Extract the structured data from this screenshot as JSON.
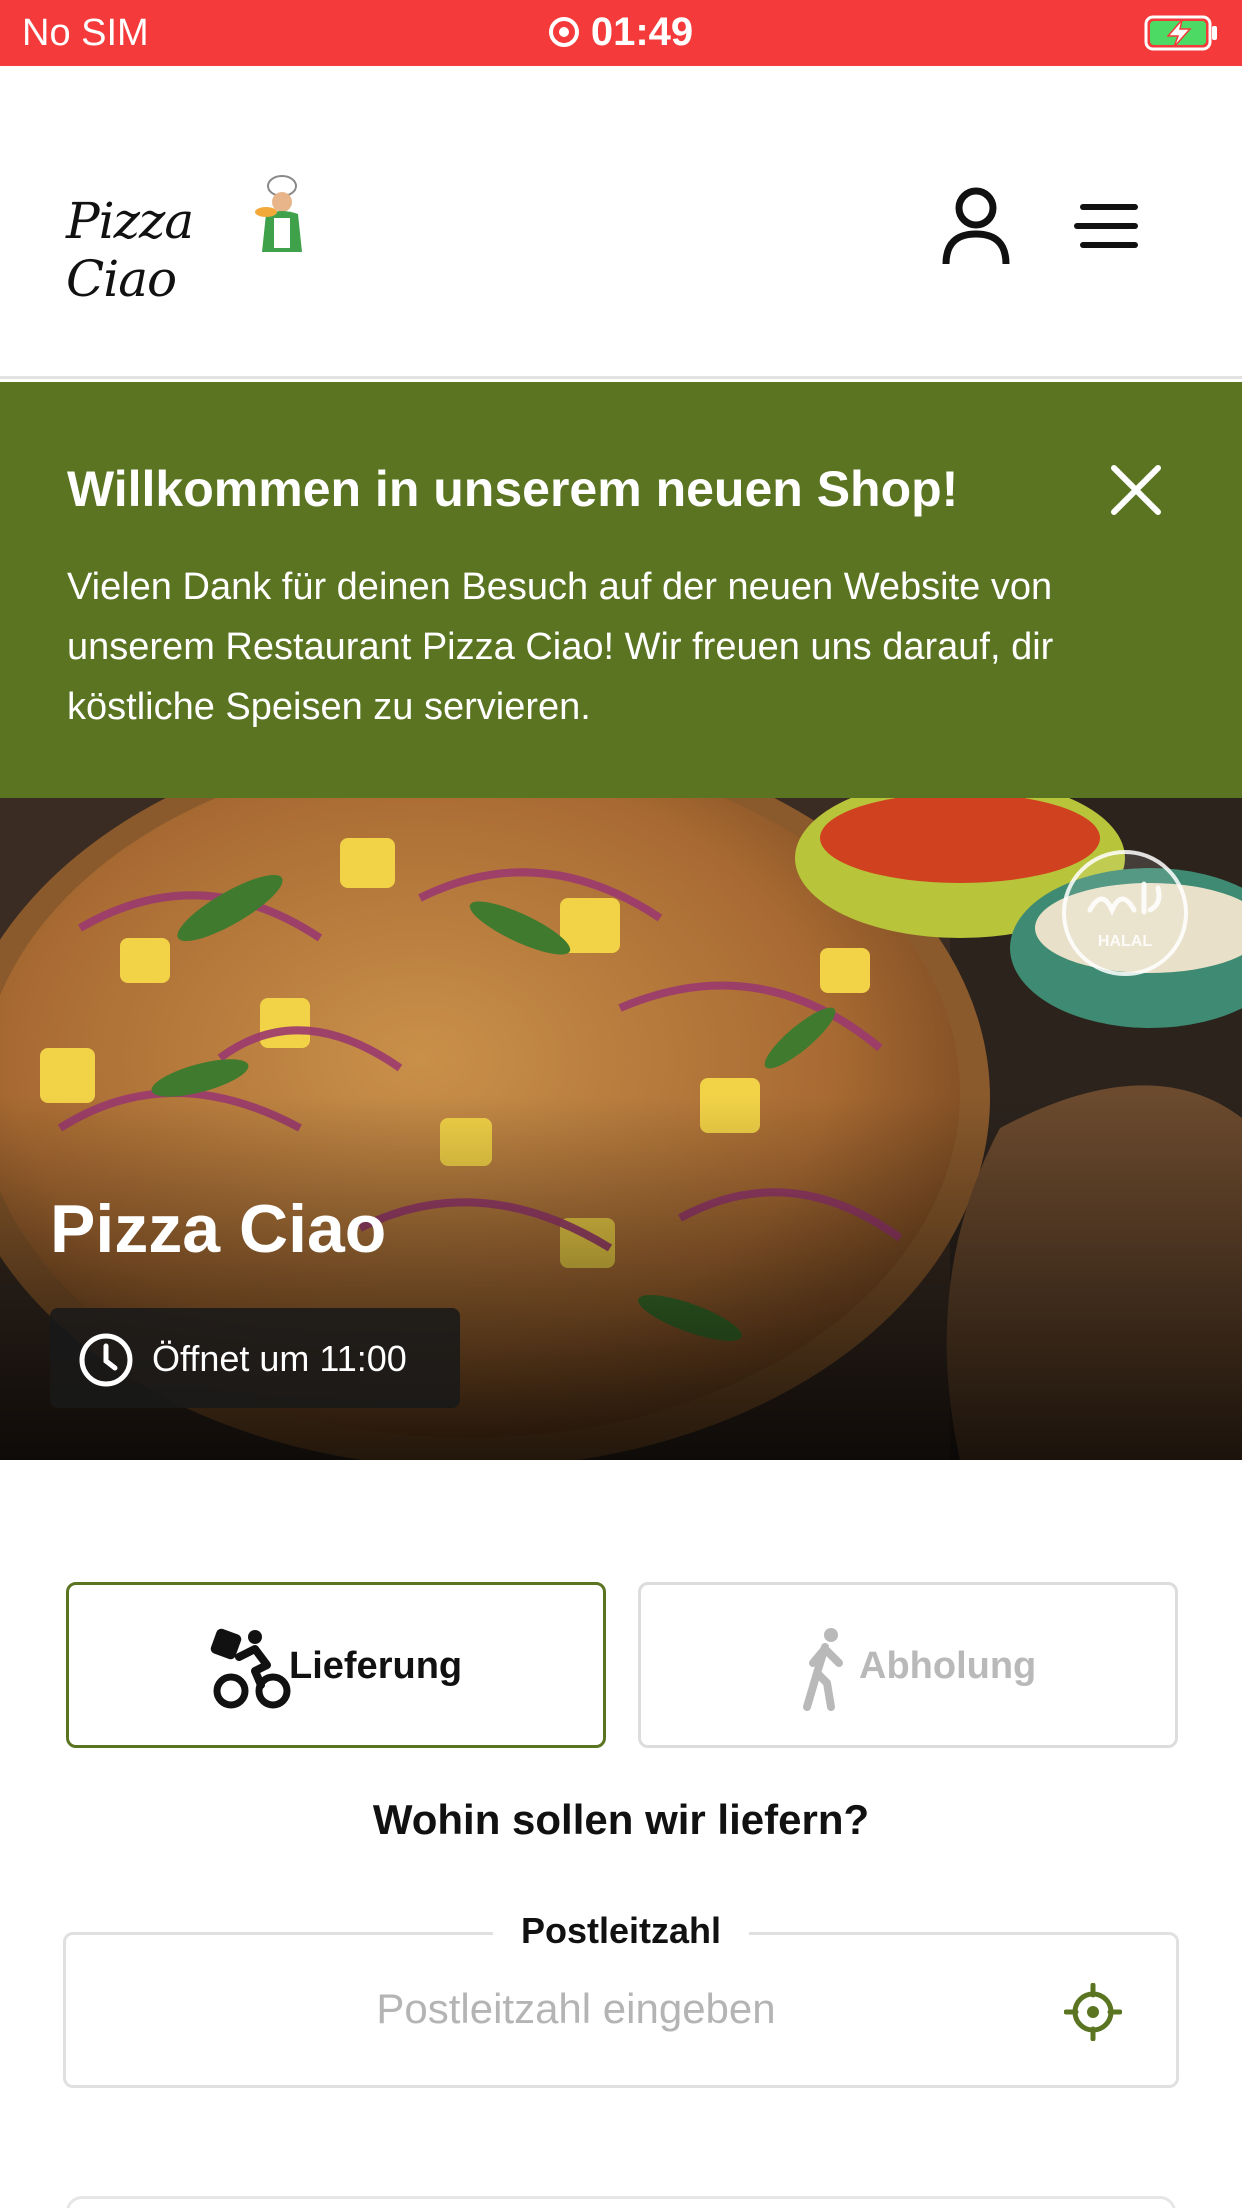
{
  "status_bar": {
    "carrier": "No SIM",
    "time": "01:49",
    "icons": [
      "recording-icon",
      "battery-charging-icon"
    ]
  },
  "header": {
    "logo_text": "Pizza Ciao",
    "icons": [
      "account-icon",
      "hamburger-menu-icon"
    ]
  },
  "banner": {
    "title": "Willkommen in unserem neuen Shop!",
    "text": "Vielen Dank für deinen Besuch auf der neuen Website von unserem Restaurant Pizza Ciao! Wir freuen uns darauf, dir köstliche Speisen zu servieren.",
    "background": "#5a7421"
  },
  "hero": {
    "title": "Pizza Ciao",
    "status": "Öffnet um 11:00",
    "badge_text": "HALAL"
  },
  "order_modes": [
    {
      "label": "Lieferung",
      "icon": "delivery-bike-icon",
      "selected": true
    },
    {
      "label": "Abholung",
      "icon": "walking-person-icon",
      "selected": false
    }
  ],
  "delivery": {
    "question": "Wohin sollen wir liefern?",
    "postal_label": "Postleitzahl",
    "postal_placeholder": "Postleitzahl eingeben",
    "postal_value": ""
  },
  "colors": {
    "status_bar": "#f43a3a",
    "accent": "#5a7421",
    "muted": "#b9b9b9"
  }
}
